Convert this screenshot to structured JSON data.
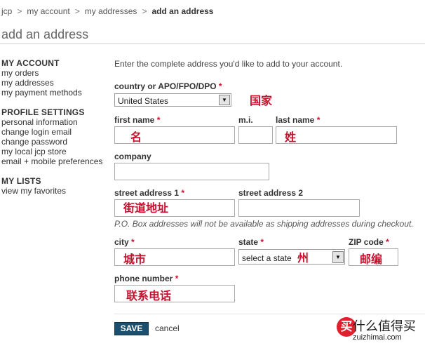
{
  "breadcrumb": [
    "jcp",
    "my account",
    "my addresses",
    "add an address"
  ],
  "page_title": "add an address",
  "sidebar": {
    "sections": [
      {
        "heading": "MY ACCOUNT",
        "links": [
          "my orders",
          "my addresses",
          "my payment methods"
        ]
      },
      {
        "heading": "PROFILE SETTINGS",
        "links": [
          "personal information",
          "change login email",
          "change password",
          "my local jcp store",
          "email + mobile preferences"
        ]
      },
      {
        "heading": "MY LISTS",
        "links": [
          "view my favorites"
        ]
      }
    ]
  },
  "form": {
    "intro": "Enter the complete address you'd like to add to your account.",
    "country_label": "country or APO/FPO/DPO",
    "country_value": "United States",
    "first_name_label": "first name",
    "mi_label": "m.i.",
    "last_name_label": "last name",
    "company_label": "company",
    "street1_label": "street address 1",
    "street2_label": "street address 2",
    "po_note": "P.O. Box addresses will not be available as shipping addresses during checkout.",
    "city_label": "city",
    "state_label": "state",
    "state_value": "select a state",
    "zip_label": "ZIP code",
    "phone_label": "phone number",
    "required_mark": "*",
    "save_label": "SAVE",
    "cancel_label": "cancel"
  },
  "annotations": {
    "country": "国家",
    "first_name": "名",
    "last_name": "姓",
    "street": "街道地址",
    "city": "城市",
    "state": "州",
    "zip": "邮编",
    "phone": "联系电话"
  },
  "watermark": {
    "icon_char": "买",
    "name": "什么值得买",
    "url": "zuizhimai.com"
  },
  "colors": {
    "required": "#c8102e",
    "save_button": "#1c4f6e",
    "annotation": "#c8102e"
  }
}
